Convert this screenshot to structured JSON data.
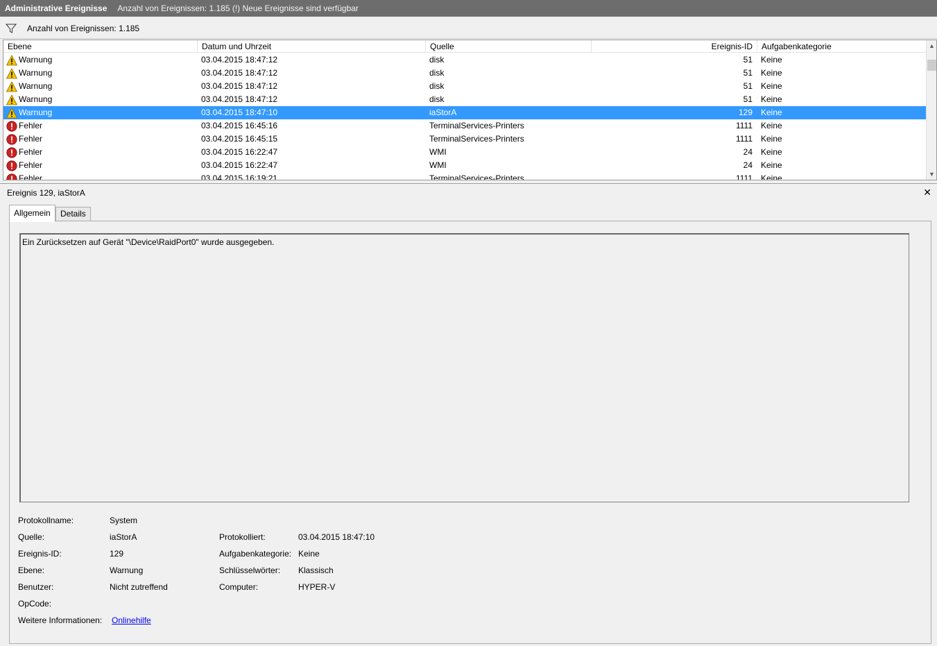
{
  "title_bar": {
    "title": "Administrative Ereignisse",
    "subtitle": "Anzahl von Ereignissen: 1.185 (!) Neue Ereignisse sind verfügbar"
  },
  "filter_bar": {
    "count_text": "Anzahl von Ereignissen: 1.185"
  },
  "grid": {
    "columns": [
      "Ebene",
      "Datum und Uhrzeit",
      "Quelle",
      "Ereignis-ID",
      "Aufgabenkategorie"
    ],
    "rows": [
      {
        "level": "Warnung",
        "icon": "warning-icon",
        "date": "03.04.2015 18:47:12",
        "source": "disk",
        "id": "51",
        "category": "Keine",
        "selected": false
      },
      {
        "level": "Warnung",
        "icon": "warning-icon",
        "date": "03.04.2015 18:47:12",
        "source": "disk",
        "id": "51",
        "category": "Keine",
        "selected": false
      },
      {
        "level": "Warnung",
        "icon": "warning-icon",
        "date": "03.04.2015 18:47:12",
        "source": "disk",
        "id": "51",
        "category": "Keine",
        "selected": false
      },
      {
        "level": "Warnung",
        "icon": "warning-icon",
        "date": "03.04.2015 18:47:12",
        "source": "disk",
        "id": "51",
        "category": "Keine",
        "selected": false
      },
      {
        "level": "Warnung",
        "icon": "warning-icon",
        "date": "03.04.2015 18:47:10",
        "source": "iaStorA",
        "id": "129",
        "category": "Keine",
        "selected": true
      },
      {
        "level": "Fehler",
        "icon": "error-icon",
        "date": "03.04.2015 16:45:16",
        "source": "TerminalServices-Printers",
        "id": "1111",
        "category": "Keine",
        "selected": false
      },
      {
        "level": "Fehler",
        "icon": "error-icon",
        "date": "03.04.2015 16:45:15",
        "source": "TerminalServices-Printers",
        "id": "1111",
        "category": "Keine",
        "selected": false
      },
      {
        "level": "Fehler",
        "icon": "error-icon",
        "date": "03.04.2015 16:22:47",
        "source": "WMI",
        "id": "24",
        "category": "Keine",
        "selected": false
      },
      {
        "level": "Fehler",
        "icon": "error-icon",
        "date": "03.04.2015 16:22:47",
        "source": "WMI",
        "id": "24",
        "category": "Keine",
        "selected": false
      },
      {
        "level": "Fehler",
        "icon": "error-icon",
        "date": "03.04.2015 16:19:21",
        "source": "TerminalServices-Printers",
        "id": "1111",
        "category": "Keine",
        "selected": false
      }
    ]
  },
  "detail": {
    "header": "Ereignis 129, iaStorA",
    "tabs": [
      {
        "label": "Allgemein",
        "active": true
      },
      {
        "label": "Details",
        "active": false
      }
    ],
    "message": "Ein Zurücksetzen auf Gerät \"\\Device\\RaidPort0\" wurde ausgegeben.",
    "properties": {
      "log_name_label": "Protokollname:",
      "log_name": "System",
      "source_label": "Quelle:",
      "source": "iaStorA",
      "logged_label": "Protokolliert:",
      "logged": "03.04.2015 18:47:10",
      "event_id_label": "Ereignis-ID:",
      "event_id": "129",
      "category_label": "Aufgabenkategorie:",
      "category": "Keine",
      "level_label": "Ebene:",
      "level": "Warnung",
      "keywords_label": "Schlüsselwörter:",
      "keywords": "Klassisch",
      "user_label": "Benutzer:",
      "user": "Nicht zutreffend",
      "computer_label": "Computer:",
      "computer": "HYPER-V",
      "opcode_label": "OpCode:",
      "opcode": "",
      "more_info_label": "Weitere Informationen:",
      "more_info_link": "Onlinehilfe"
    }
  },
  "colors": {
    "selection": "#3399ff",
    "title_bar": "#6d6d6d",
    "warning": "#f5c400",
    "error": "#cc2222",
    "link": "#0000ee"
  }
}
